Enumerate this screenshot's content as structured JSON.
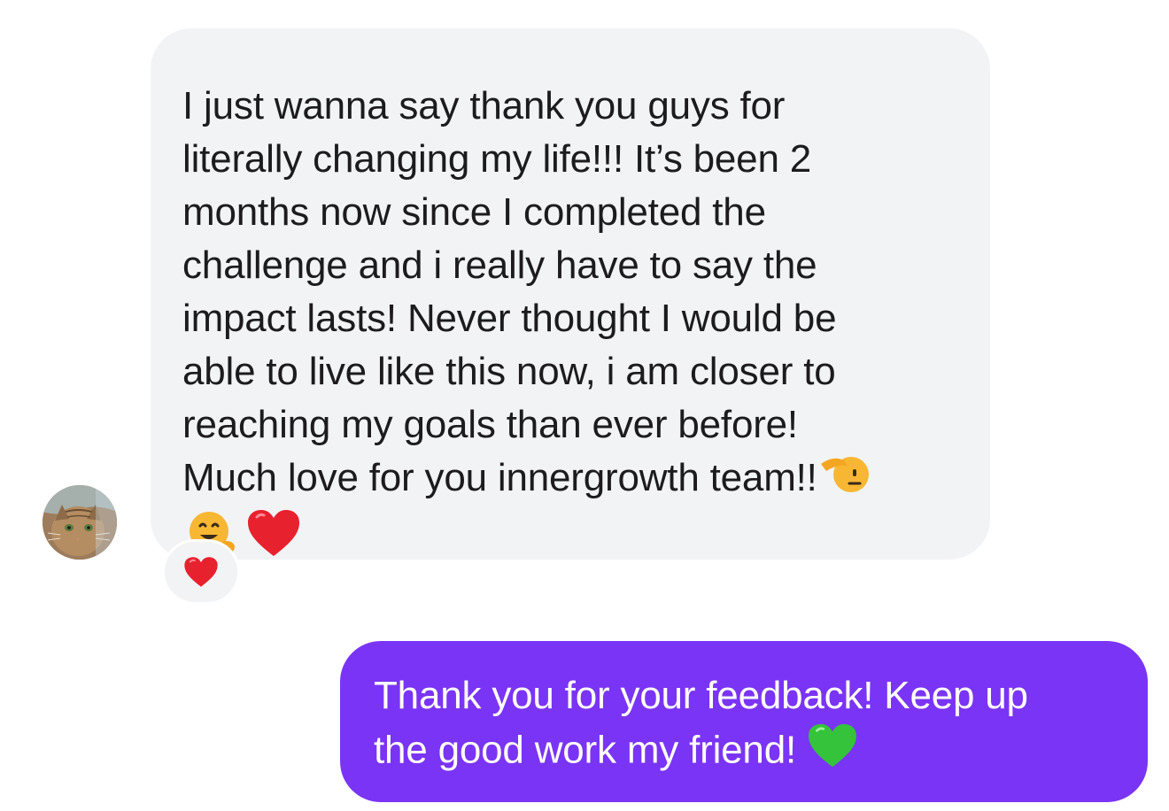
{
  "conversation": {
    "incoming": {
      "lines": [
        "I just wanna say thank you guys for",
        "literally changing my life!!! It’s been 2",
        "months now since I completed the",
        "challenge and i really have to say the",
        "impact lasts! Never thought I would be",
        "able to live like this now, i am closer to",
        "reaching my goals than ever before!",
        "Much love for you innergrowth team!!"
      ],
      "trailing_emojis": [
        "saluting-face",
        "hugging-face",
        "red-heart"
      ],
      "reaction": "red-heart",
      "bubble_color": "#f2f3f5"
    },
    "outgoing": {
      "lines": [
        "Thank you for your feedback! Keep up",
        "the good work my friend!"
      ],
      "trailing_emoji": "green-heart",
      "bubble_color": "#7a34f5"
    }
  }
}
